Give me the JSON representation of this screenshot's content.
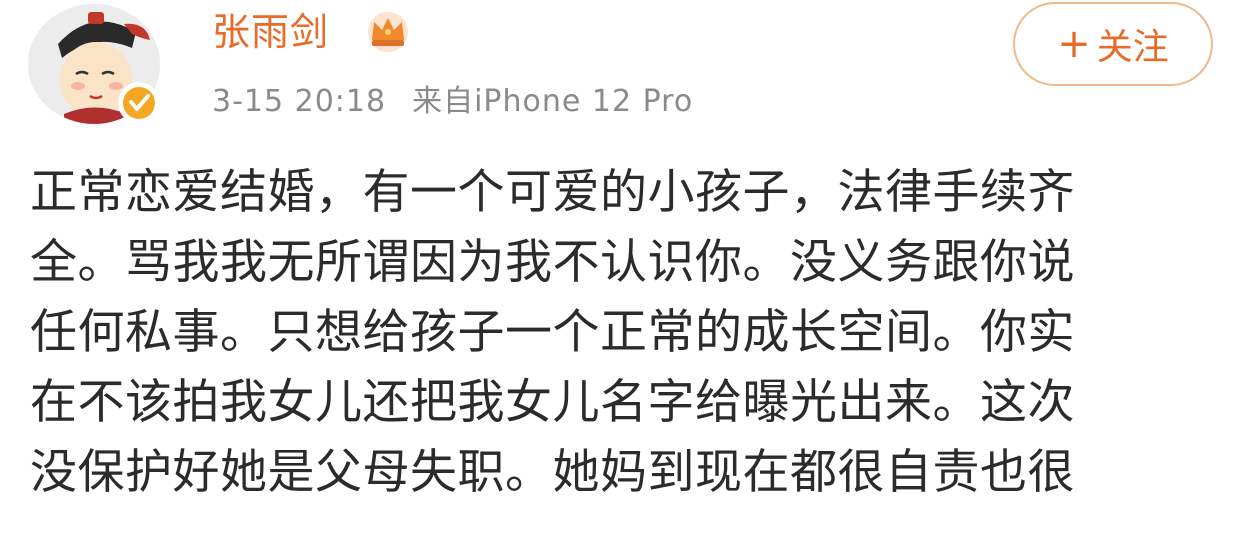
{
  "post": {
    "username": "张雨剑",
    "timestamp": "3-15 20:18",
    "source": "来自iPhone 12 Pro",
    "follow_button": {
      "plus": "+",
      "label": "关注"
    },
    "avatar_icon": "cartoon-avatar-icon",
    "verified_icon": "verified-badge-icon",
    "vip_icon": "crown-icon",
    "content_lines": [
      "正常恋爱结婚，有一个可爱的小孩子，法律手续齐",
      "全。骂我我无所谓因为我不认识你。没义务跟你说",
      "任何私事。只想给孩子一个正常的成长空间。你实",
      "在不该拍我女儿还把我女儿名字给曝光出来。这次",
      "没保护好她是父母失职。她妈到现在都很自责也很"
    ]
  },
  "colors": {
    "username": "#e86b2a",
    "follow_border": "#f0b98a",
    "meta": "#8a8a8a",
    "text": "#2b2b2b",
    "verified": "#f5a623"
  }
}
